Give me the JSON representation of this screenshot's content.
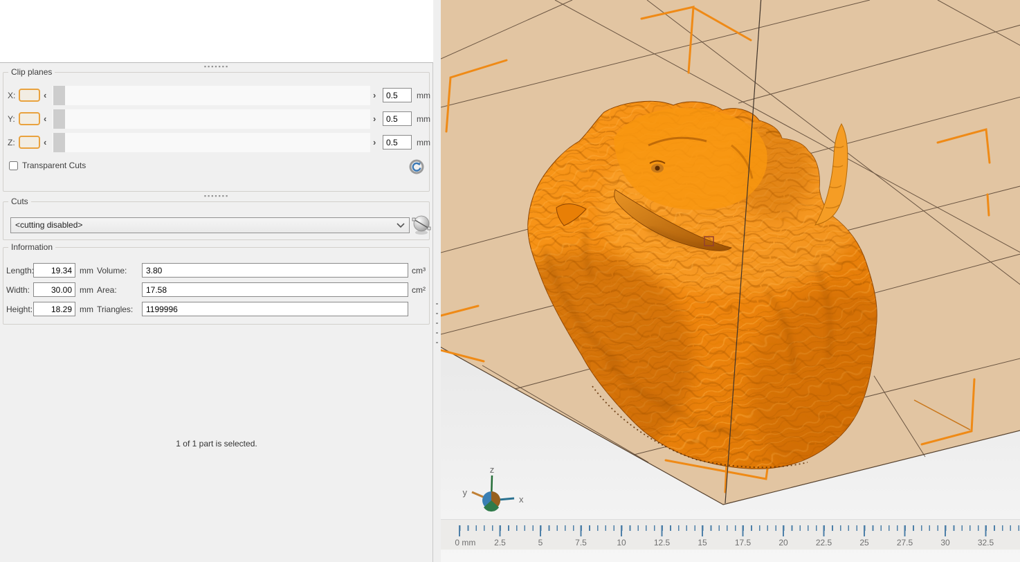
{
  "panel": {
    "clip_planes": {
      "title": "Clip planes",
      "rows": [
        {
          "label": "X:",
          "value": "0.5",
          "unit": "mm"
        },
        {
          "label": "Y:",
          "value": "0.5",
          "unit": "mm"
        },
        {
          "label": "Z:",
          "value": "0.5",
          "unit": "mm"
        }
      ],
      "transparent_cuts_label": "Transparent Cuts"
    },
    "cuts": {
      "title": "Cuts",
      "selected": "<cutting disabled>"
    },
    "information": {
      "title": "Information",
      "rows": [
        {
          "l1": "Length:",
          "v1": "19.34",
          "u1": "mm",
          "l2": "Volume:",
          "v2": "3.80",
          "u2": "cm³"
        },
        {
          "l1": "Width:",
          "v1": "30.00",
          "u1": "mm",
          "l2": "Area:",
          "v2": "17.58",
          "u2": "cm²"
        },
        {
          "l1": "Height:",
          "v1": "18.29",
          "u1": "mm",
          "l2": "Triangles:",
          "v2": "1199996",
          "u2": ""
        }
      ]
    },
    "status": "1 of 1 part is selected.",
    "icons": {
      "slider_left": "‹",
      "slider_right": "›"
    }
  },
  "viewport": {
    "axis_labels": {
      "x": "x",
      "y": "y",
      "z": "z"
    },
    "ruler": {
      "labels": [
        "0 mm",
        "2.5",
        "5",
        "7.5",
        "10",
        "12.5",
        "15",
        "17.5",
        "20",
        "22.5",
        "25",
        "27.5",
        "30",
        "32.5"
      ]
    },
    "colors": {
      "platform": "#e2c5a2",
      "model_orange": "#f1870f",
      "marker_orange": "#ef8a16",
      "tick_blue": "#4d7fa8"
    }
  }
}
